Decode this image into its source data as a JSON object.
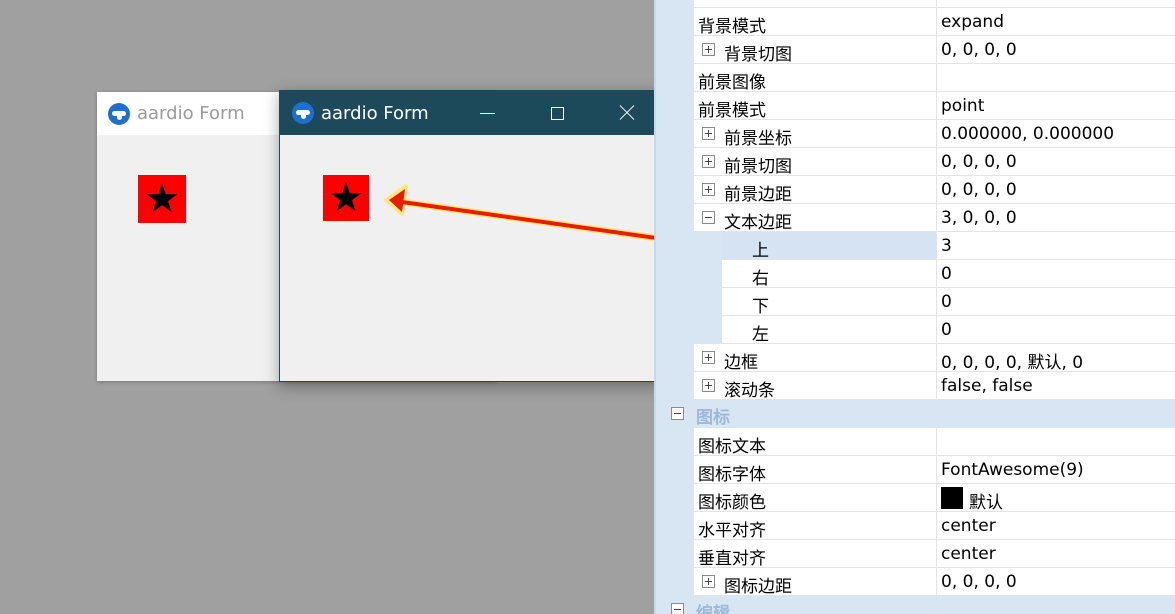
{
  "back_window": {
    "title": "aardio Form",
    "icon_glyph": "★"
  },
  "front_window": {
    "title": "aardio Form",
    "icon_glyph": "★"
  },
  "colors": {
    "icon_bg": "#ff0000",
    "front_titlebar": "#1c4a5a",
    "arrow": "#ff0000",
    "arrow_outline": "#ffe680",
    "grid_gutter": "#d8e6f3",
    "selected_row": "#d5e3f2"
  },
  "icons": [
    "app-logo-icon",
    "minimize-icon",
    "maximize-icon",
    "close-icon",
    "star-icon",
    "expand-icon",
    "collapse-icon"
  ],
  "property_grid": {
    "rows": [
      {
        "name": "背景模式",
        "value": "expand"
      },
      {
        "name": "背景切图",
        "value": "0, 0, 0, 0",
        "expander": "plus"
      },
      {
        "name": "前景图像",
        "value": ""
      },
      {
        "name": "前景模式",
        "value": "point"
      },
      {
        "name": "前景坐标",
        "value": "0.000000, 0.000000",
        "expander": "plus"
      },
      {
        "name": "前景切图",
        "value": "0, 0, 0, 0",
        "expander": "plus"
      },
      {
        "name": "前景边距",
        "value": "0, 0, 0, 0",
        "expander": "plus"
      },
      {
        "name": "文本边距",
        "value": "3, 0, 0, 0",
        "expander": "minus"
      },
      {
        "name": "上",
        "value": "3",
        "child": true,
        "selected": true
      },
      {
        "name": "右",
        "value": "0",
        "child": true
      },
      {
        "name": "下",
        "value": "0",
        "child": true
      },
      {
        "name": "左",
        "value": "0",
        "child": true
      },
      {
        "name": "边框",
        "value": "0, 0, 0, 0, 默认, 0",
        "expander": "plus"
      },
      {
        "name": "滚动条",
        "value": "false, false",
        "expander": "plus"
      }
    ],
    "category_icon": "图标",
    "icon_rows": [
      {
        "name": "图标文本",
        "value": ""
      },
      {
        "name": "图标字体",
        "value": "FontAwesome(9)"
      },
      {
        "name": "图标颜色",
        "value": "默认",
        "swatch": "#000000"
      },
      {
        "name": "水平对齐",
        "value": "center"
      },
      {
        "name": "垂直对齐",
        "value": "center"
      },
      {
        "name": "图标边距",
        "value": "0, 0, 0, 0",
        "expander": "plus"
      }
    ],
    "category_edit": "编辑"
  }
}
